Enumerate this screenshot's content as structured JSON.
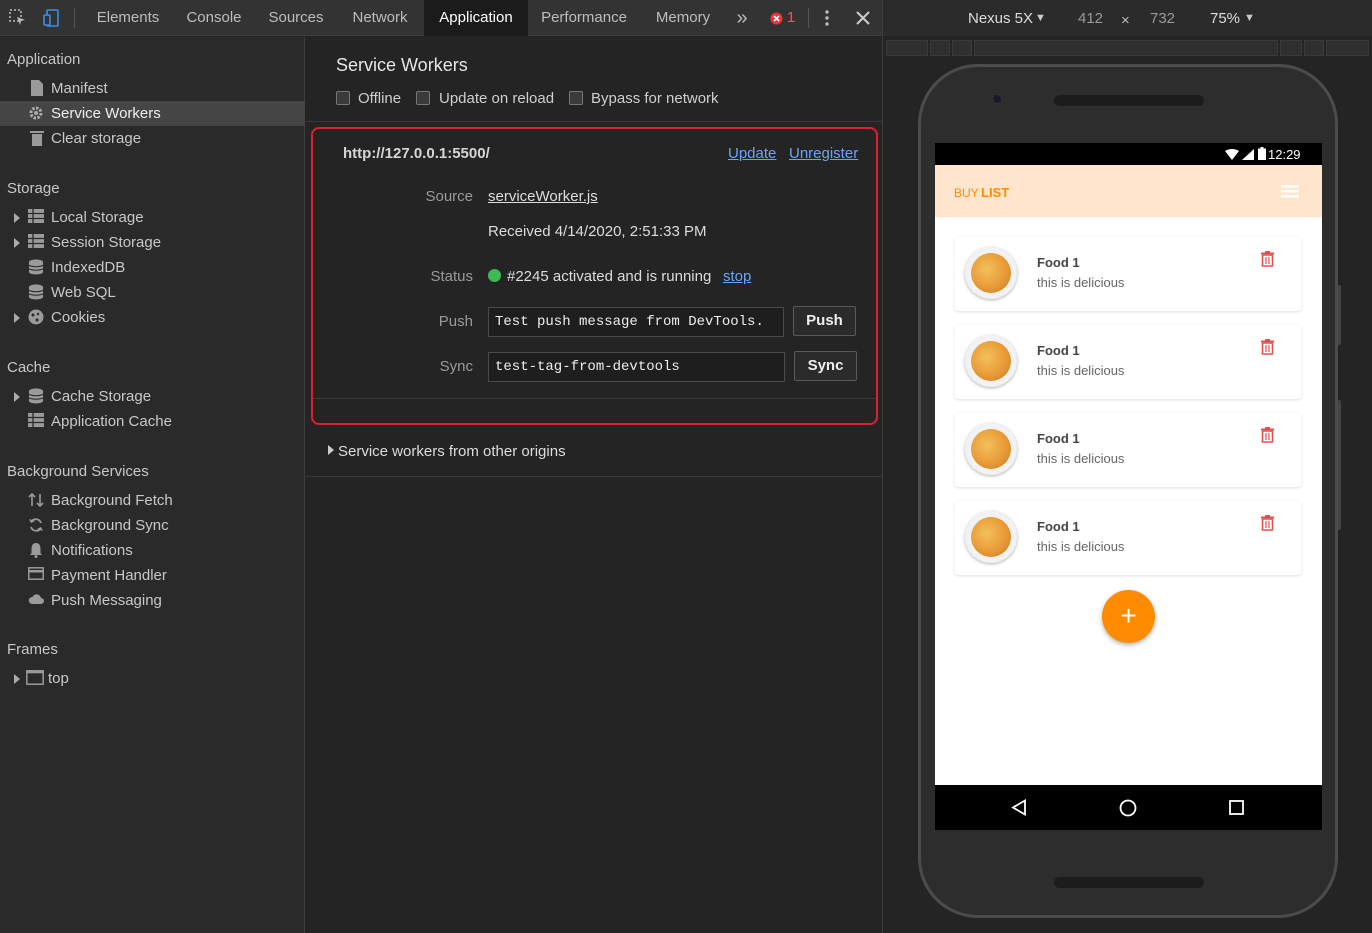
{
  "toolbar": {
    "tabs": [
      {
        "label": "Elements"
      },
      {
        "label": "Console"
      },
      {
        "label": "Sources"
      },
      {
        "label": "Network"
      },
      {
        "label": "Application",
        "active": true
      },
      {
        "label": "Performance"
      },
      {
        "label": "Memory"
      }
    ],
    "more_label": "»",
    "error_count": "1"
  },
  "device_bar": {
    "device": "Nexus 5X",
    "width": "412",
    "times": "×",
    "height": "732",
    "zoom": "75%"
  },
  "sidebar": {
    "application_header": "Application",
    "application_items": [
      {
        "label": "Manifest"
      },
      {
        "label": "Service Workers"
      },
      {
        "label": "Clear storage"
      }
    ],
    "storage_header": "Storage",
    "storage_items": [
      {
        "label": "Local Storage"
      },
      {
        "label": "Session Storage"
      },
      {
        "label": "IndexedDB"
      },
      {
        "label": "Web SQL"
      },
      {
        "label": "Cookies"
      }
    ],
    "cache_header": "Cache",
    "cache_items": [
      {
        "label": "Cache Storage"
      },
      {
        "label": "Application Cache"
      }
    ],
    "bg_header": "Background Services",
    "bg_items": [
      {
        "label": "Background Fetch"
      },
      {
        "label": "Background Sync"
      },
      {
        "label": "Notifications"
      },
      {
        "label": "Payment Handler"
      },
      {
        "label": "Push Messaging"
      }
    ],
    "frames_header": "Frames",
    "frames_items": [
      {
        "label": "top"
      }
    ]
  },
  "main": {
    "title": "Service Workers",
    "options": [
      {
        "label": "Offline"
      },
      {
        "label": "Update on reload"
      },
      {
        "label": "Bypass for network"
      }
    ],
    "worker": {
      "url": "http://127.0.0.1:5500/",
      "update_link": "Update",
      "unregister_link": "Unregister",
      "source_label": "Source",
      "source_file": "serviceWorker.js",
      "received": "Received 4/14/2020, 2:51:33 PM",
      "status_label": "Status",
      "status_text": "#2245 activated and is running",
      "stop_link": "stop",
      "push_label": "Push",
      "push_value": "Test push message from DevTools.",
      "push_button": "Push",
      "sync_label": "Sync",
      "sync_value": "test-tag-from-devtools",
      "sync_button": "Sync"
    },
    "other_origins": "Service workers from other origins"
  },
  "phone": {
    "time": "12:29",
    "app_title_part1": "BUY",
    "app_title_part2": "LIST",
    "items": [
      {
        "title": "Food 1",
        "subtitle": "this is delicious"
      },
      {
        "title": "Food 1",
        "subtitle": "this is delicious"
      },
      {
        "title": "Food 1",
        "subtitle": "this is delicious"
      },
      {
        "title": "Food 1",
        "subtitle": "this is delicious"
      }
    ],
    "fab_label": "+"
  },
  "colors": {
    "accent": "#ff8c00",
    "highlight_border": "#e01e2e",
    "status_green": "#3cba54",
    "link": "#6aa3ff"
  }
}
